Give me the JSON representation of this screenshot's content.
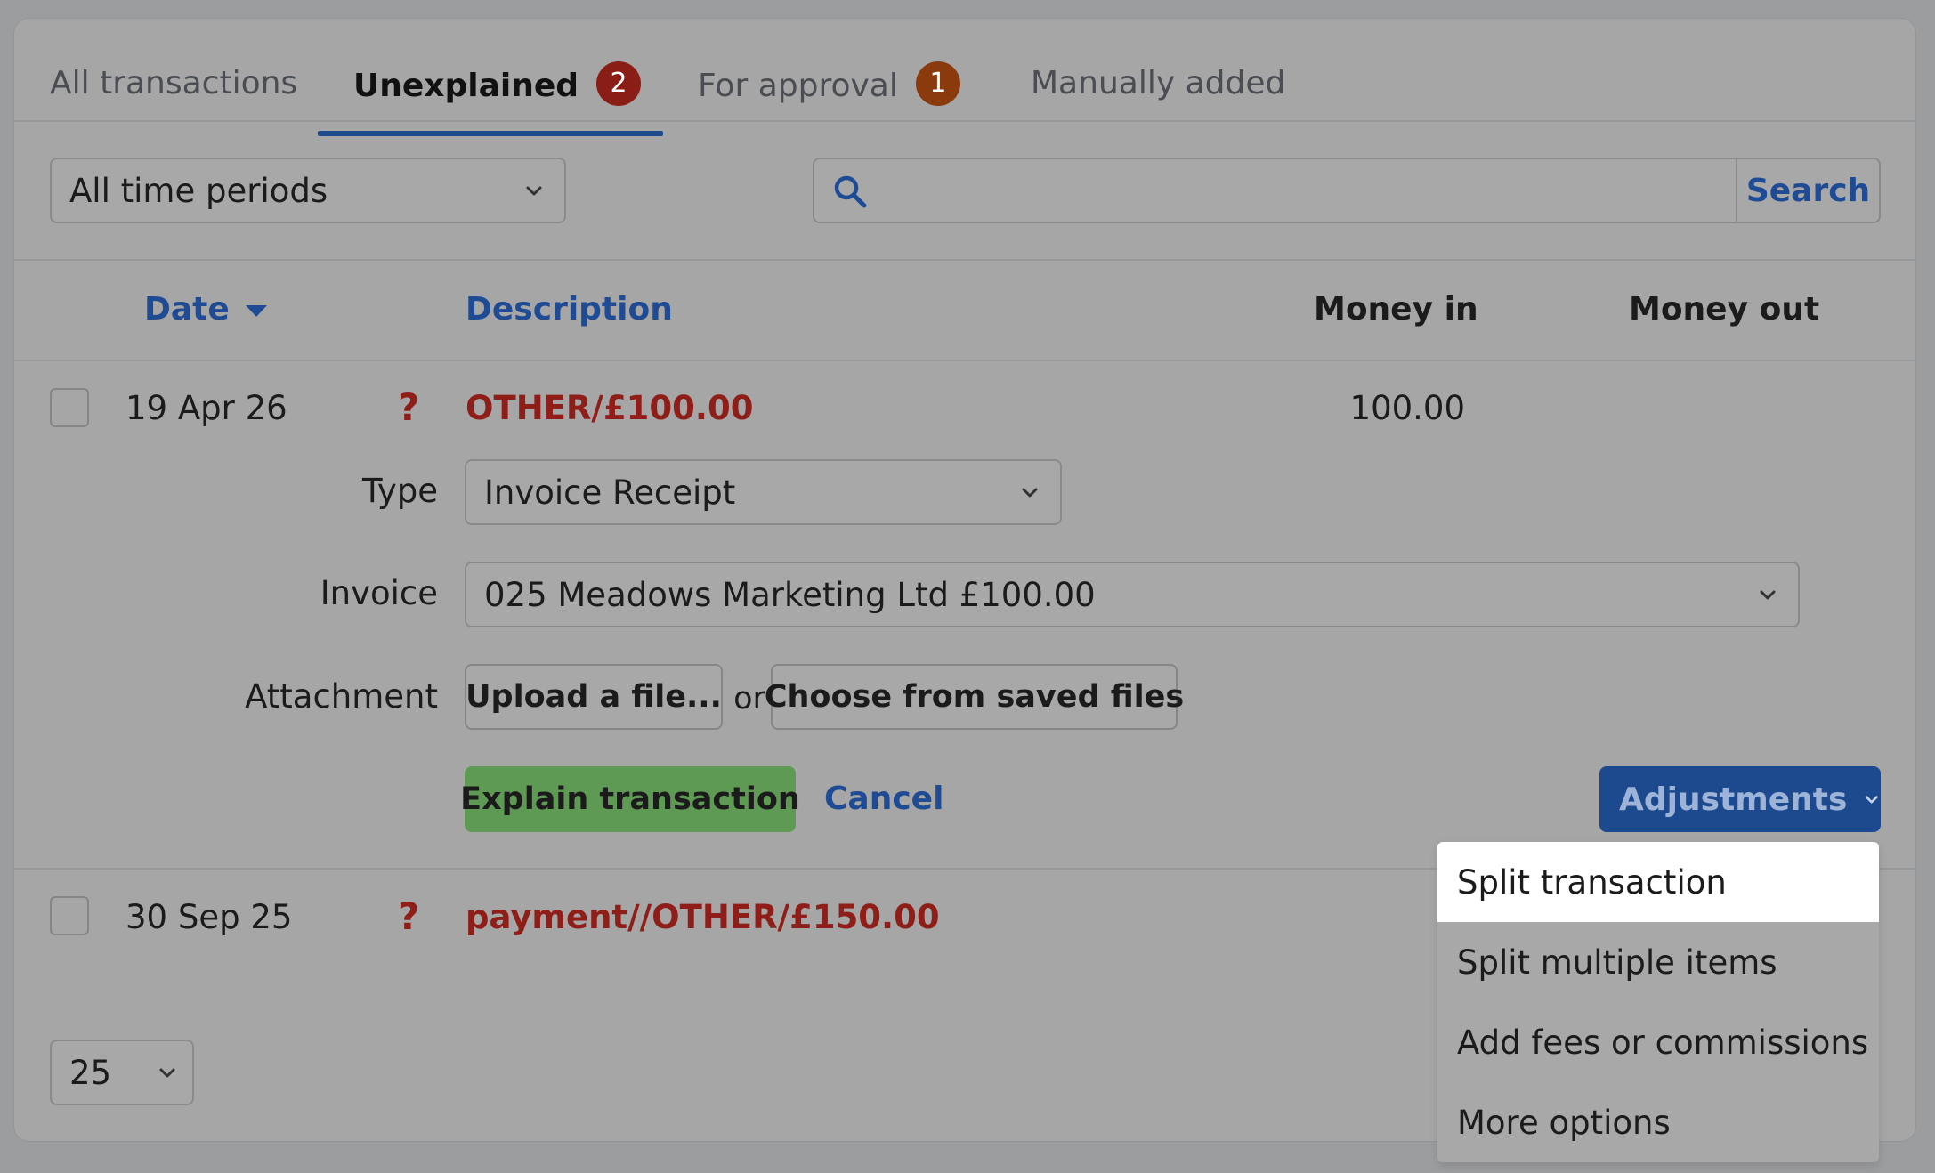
{
  "tabs": [
    {
      "label": "All transactions",
      "badge": null,
      "active": false
    },
    {
      "label": "Unexplained",
      "badge": "2",
      "active": true
    },
    {
      "label": "For approval",
      "badge": "1",
      "active": false
    },
    {
      "label": "Manually added",
      "badge": null,
      "active": false
    }
  ],
  "filters": {
    "period_value": "All time periods",
    "search_value": "",
    "search_button": "Search"
  },
  "table": {
    "headers": {
      "date": "Date",
      "description": "Description",
      "money_in": "Money in",
      "money_out": "Money out"
    },
    "rows": [
      {
        "date": "19 Apr 26",
        "status": "?",
        "description": "OTHER/£100.00",
        "money_in": "100.00",
        "money_out": ""
      },
      {
        "date": "30 Sep 25",
        "status": "?",
        "description": "payment//OTHER/£150.00",
        "money_in": "",
        "money_out": ""
      }
    ]
  },
  "explain_form": {
    "type_label": "Type",
    "type_value": "Invoice Receipt",
    "invoice_label": "Invoice",
    "invoice_value": "025 Meadows Marketing Ltd £100.00",
    "attachment_label": "Attachment",
    "upload_button": "Upload a file...",
    "or_text": "or",
    "choose_saved_button": "Choose from saved files",
    "explain_button": "Explain transaction",
    "cancel_link": "Cancel",
    "adjustments_button": "Adjustments"
  },
  "adjustments_menu": {
    "items": [
      "Split transaction",
      "Split multiple items",
      "Add fees or commissions",
      "More options"
    ]
  },
  "pagination": {
    "per_page": "25"
  },
  "colors": {
    "accent": "#1d4a8e",
    "danger": "#8f1e18",
    "badge_red": "#8b1d17",
    "badge_orange": "#8a3a0c",
    "success": "#5f9a55"
  }
}
